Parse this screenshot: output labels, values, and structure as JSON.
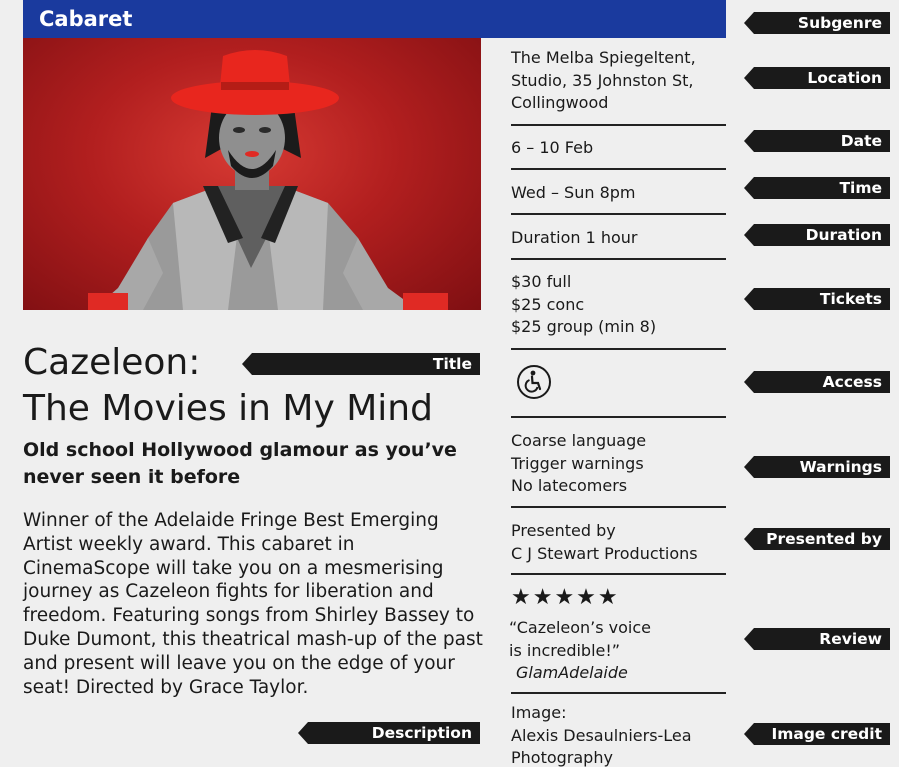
{
  "subgenre": "Cabaret",
  "title_line1": "Cazeleon:",
  "title_line2": "The Movies in My Mind",
  "subtitle": "Old school Hollywood glamour as you’ve never seen it before",
  "description": "Winner of the Adelaide Fringe Best Emerging Artist weekly award. This cabaret in CinemaScope will take you on a mesmerising journey as Cazeleon fights for liberation and freedom. Featuring songs from Shirley Bassey to Duke Dumont, this theatrical mash-up of the past and present will leave you on the edge of your seat! Directed by Grace Taylor.",
  "info": {
    "location": [
      "The Melba Spiegeltent,",
      "Studio, 35 Johnston St,",
      "Collingwood"
    ],
    "date": "6 – 10 Feb",
    "time": "Wed – Sun 8pm",
    "duration": "Duration 1 hour",
    "tickets": [
      "$30 full",
      "$25 conc",
      "$25 group (min 8)"
    ],
    "access_icon": "wheelchair-access-icon",
    "warnings": [
      "Coarse language",
      "Trigger warnings",
      "No latecomers"
    ],
    "presented_by": [
      "Presented by",
      "C J Stewart Productions"
    ],
    "review_stars": "★★★★★",
    "review_quote": [
      "“Cazeleon’s voice",
      " is incredible!”"
    ],
    "review_source": "GlamAdelaide",
    "image_credit": [
      "Image:",
      "Alexis Desaulniers-Lea",
      "Photography"
    ]
  },
  "tags": {
    "subgenre": "Subgenre",
    "location": "Location",
    "date": "Date",
    "time": "Time",
    "duration": "Duration",
    "tickets": "Tickets",
    "access": "Access",
    "warnings": "Warnings",
    "presented_by": "Presented by",
    "review": "Review",
    "image_credit": "Image credit",
    "title": "Title",
    "description": "Description"
  },
  "colors": {
    "subgenre_bar": "#1a3a9e",
    "photo_background": "#b21f1f",
    "tag_background": "#1a1a1a"
  }
}
